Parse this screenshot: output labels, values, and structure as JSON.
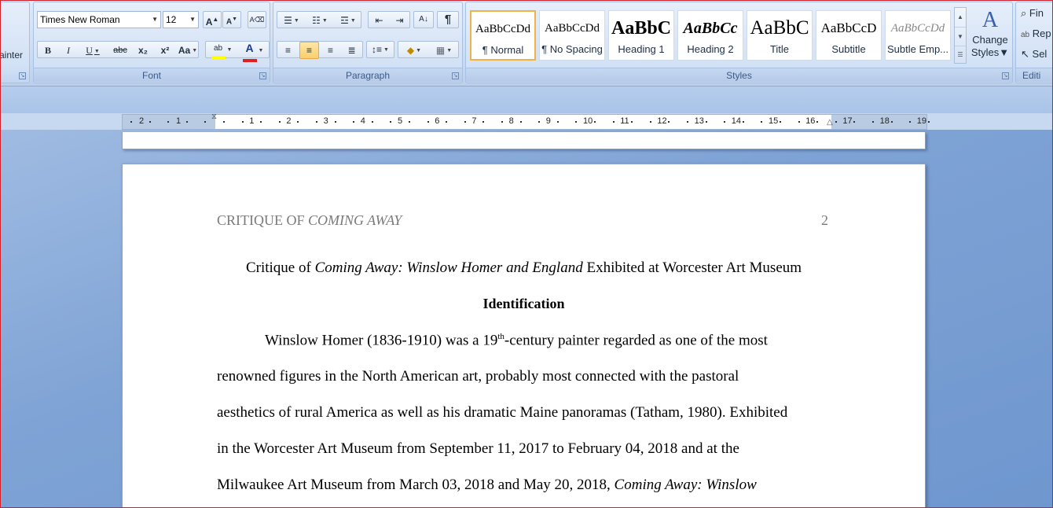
{
  "ribbon": {
    "clipboard": {
      "format_painter_partial": "ainter"
    },
    "font": {
      "label": "Font",
      "font_name": "Times New Roman",
      "font_size": "12",
      "grow_label": "A",
      "shrink_label": "A",
      "bold_label": "B",
      "italic_label": "I",
      "underline_label": "U",
      "strike_label": "abc",
      "subscript_label": "x₂",
      "superscript_label": "x²",
      "change_case_label": "Aa",
      "highlight_label": "ab",
      "font_color_label": "A",
      "highlight_color": "#ffff00",
      "font_color": "#e02020"
    },
    "paragraph": {
      "label": "Paragraph",
      "show_marks_label": "¶"
    },
    "styles": {
      "label": "Styles",
      "items": [
        {
          "sample": "AaBbCcDd",
          "name": "¶ Normal"
        },
        {
          "sample": "AaBbCcDd",
          "name": "¶ No Spacing"
        },
        {
          "sample": "AaBbC",
          "name": "Heading 1"
        },
        {
          "sample": "AaBbCc",
          "name": "Heading 2"
        },
        {
          "sample": "AaBbC",
          "name": "Title"
        },
        {
          "sample": "AaBbCcD",
          "name": "Subtitle"
        },
        {
          "sample": "AaBbCcDd",
          "name": "Subtle Emp..."
        }
      ],
      "change_styles_label_1": "Change",
      "change_styles_label_2": "Styles"
    },
    "editing": {
      "label": "Editi",
      "find_label": "Fin",
      "replace_label": "Rep",
      "select_label": "Sel"
    }
  },
  "ruler": {
    "left_numbers": [
      "2",
      "1"
    ],
    "right_numbers": [
      "1",
      "2",
      "3",
      "4",
      "5",
      "6",
      "7",
      "8",
      "9",
      "10",
      "11",
      "12",
      "13",
      "14",
      "15",
      "16",
      "17",
      "18",
      "19"
    ]
  },
  "document": {
    "running_head_plain": "CRITIQUE OF ",
    "running_head_italic": "COMING AWAY",
    "page_number": "2",
    "title_plain_1": "Critique of ",
    "title_italic": "Coming Away: Winslow Homer and England",
    "title_plain_2": " Exhibited at Worcester Art Museum",
    "heading": "Identification",
    "line1_a": "Winslow Homer (1836-1910) was a 19",
    "line1_sup": "th",
    "line1_b": "-century painter regarded as one of the most",
    "line2": "renowned figures in the North American art, probably most connected with the pastoral",
    "line3": "aesthetics of rural America as well as his dramatic Maine panoramas (Tatham, 1980). Exhibited",
    "line4": "in the Worcester Art Museum from September 11, 2017 to February 04, 2018 and at the",
    "line5_plain": "Milwaukee Art Museum from March 03, 2018 and May 20, 2018, ",
    "line5_italic": "Coming Away: Winslow"
  }
}
